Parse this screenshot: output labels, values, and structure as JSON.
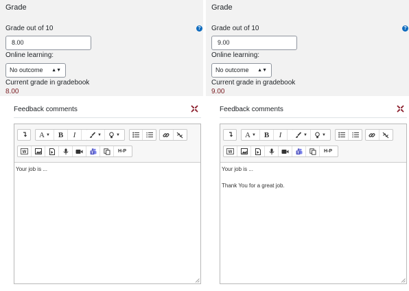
{
  "panels": [
    {
      "grade_title": "Grade",
      "grade_label": "Grade out of 10",
      "grade_value": "8.00",
      "outcome_label": "Online learning:",
      "outcome_selected": "No outcome",
      "gradebook_label": "Current grade in gradebook",
      "gradebook_value": "8.00",
      "feedback_label": "Feedback comments",
      "content": [
        "Your job is ..."
      ]
    },
    {
      "grade_title": "Grade",
      "grade_label": "Grade out of 10",
      "grade_value": "9.00",
      "outcome_label": "Online learning:",
      "outcome_selected": "No outcome",
      "gradebook_label": "Current grade in gradebook",
      "gradebook_value": "9.00",
      "feedback_label": "Feedback comments",
      "content": [
        "Your job is ...",
        "Thank You for a great job."
      ]
    }
  ],
  "toolbar": {
    "icons_row1": [
      "collapse-toolbar-icon",
      "font-style-icon",
      "bold-icon",
      "italic-icon",
      "text-color-icon",
      "highlight-icon",
      "bullet-list-icon",
      "numbered-list-icon",
      "link-icon",
      "unlink-icon"
    ],
    "icons_row2": [
      "wiris-icon",
      "image-icon",
      "media-icon",
      "record-audio-icon",
      "record-video-icon",
      "teams-icon",
      "copy-icon",
      "h5p-icon"
    ],
    "font_label": "A",
    "bold_label": "B",
    "italic_label": "I",
    "h5p_label": "H-P"
  },
  "colors": {
    "grade_bg": "#f2f2f2",
    "gradebook_value": "#7a1c21",
    "help_icon": "#0f6cbf",
    "collapse_icon": "#8b1e2c",
    "teams_icon": "#5b5fc7"
  }
}
